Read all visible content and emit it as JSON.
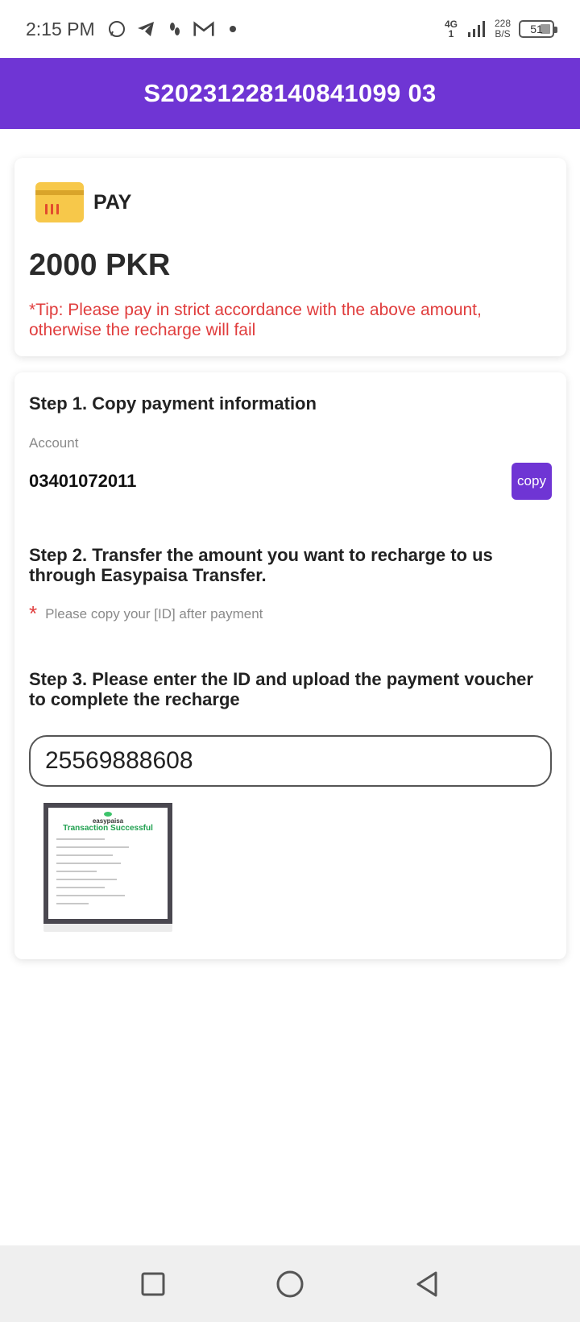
{
  "status_bar": {
    "time": "2:15 PM",
    "network_type": "4G",
    "network_sub": "1",
    "speed_value": "228",
    "speed_unit": "B/S",
    "battery": "51"
  },
  "header": {
    "title": "S20231228140841099 03"
  },
  "pay_card": {
    "label": "PAY",
    "amount": "2000 PKR",
    "tip": "*Tip: Please pay in strict accordance with the above amount, otherwise the recharge will fail"
  },
  "step1": {
    "title": "Step 1. Copy payment information",
    "account_label": "Account",
    "account_value": "03401072011",
    "copy_label": "copy"
  },
  "step2": {
    "title": "Step 2. Transfer the amount you want to recharge to us through Easypaisa Transfer.",
    "note_star": "*",
    "note": "Please copy your [ID] after payment"
  },
  "step3": {
    "title": "Step 3. Please enter the ID and upload the payment voucher to complete the recharge",
    "id_value": "25569888608"
  },
  "voucher": {
    "brand": "easypaisa",
    "status": "Transaction Successful"
  },
  "colors": {
    "brand_purple": "#6f35d4",
    "tip_red": "#e03d3d"
  }
}
